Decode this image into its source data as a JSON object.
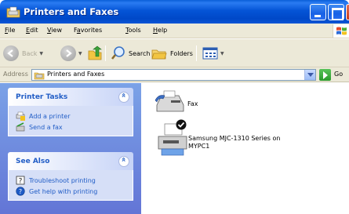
{
  "window": {
    "title": "Printers and Faxes",
    "icon": "printer-folder-icon",
    "title_bar_color": "#0454d6"
  },
  "menubar": {
    "items": [
      {
        "prefix": "",
        "key": "F",
        "rest": "ile"
      },
      {
        "prefix": "",
        "key": "E",
        "rest": "dit"
      },
      {
        "prefix": "",
        "key": "V",
        "rest": "iew"
      },
      {
        "prefix": "F",
        "key": "a",
        "rest": "vorites"
      },
      {
        "prefix": "",
        "key": "T",
        "rest": "ools"
      },
      {
        "prefix": "",
        "key": "H",
        "rest": "elp"
      }
    ]
  },
  "toolbar": {
    "back_label": "Back",
    "search_label": "Search",
    "folders_label": "Folders"
  },
  "address": {
    "label": "Address",
    "value": "Printers and Faxes",
    "go_label": "Go"
  },
  "tasks": {
    "printer_tasks": {
      "title": "Printer Tasks",
      "items": [
        "Add a printer",
        "Send a fax"
      ]
    },
    "see_also": {
      "title": "See Also",
      "items": [
        "Troubleshoot printing",
        "Get help with printing"
      ]
    }
  },
  "content": {
    "items": [
      {
        "label": "Fax",
        "icon": "fax-icon"
      },
      {
        "label_line1": "Samsung MJC-1310 Series on",
        "label_line2": "MYPC1",
        "icon": "printer-icon",
        "default": true
      }
    ]
  },
  "colors": {
    "taskpane_gradient_top": "#7ba2e7",
    "taskpane_gradient_bottom": "#6375d6",
    "link": "#215dc6",
    "chrome": "#ece9d8"
  }
}
